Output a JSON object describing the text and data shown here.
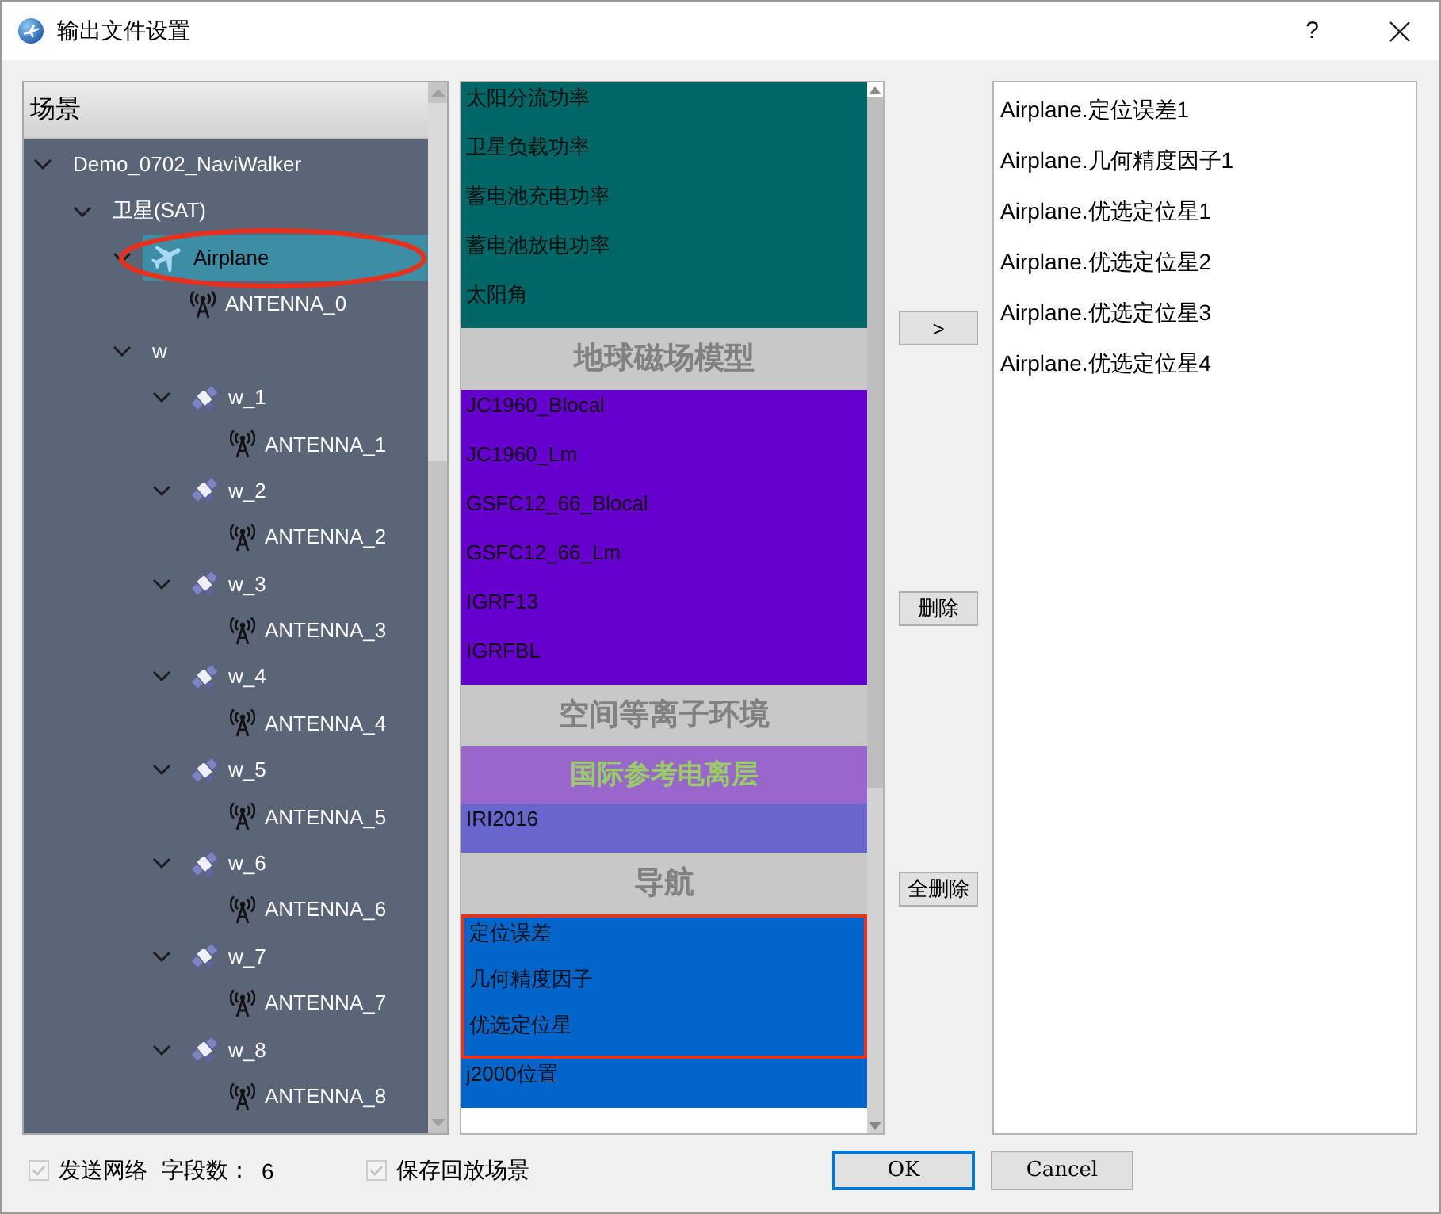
{
  "window": {
    "title": "输出文件设置",
    "help_label": "?"
  },
  "scene_tree": {
    "header": "场景",
    "nodes": [
      {
        "label": "Demo_0702_NaviWalker",
        "expanded": true,
        "selected": false,
        "circled": false,
        "children": [
          {
            "label": "卫星(SAT)",
            "expanded": true,
            "selected": false,
            "circled": false,
            "children": [
              {
                "label": "Airplane",
                "kind": "airplane",
                "expanded": true,
                "selected": true,
                "circled": true,
                "children": [
                  {
                    "label": "ANTENNA_0",
                    "kind": "antenna",
                    "selected": false,
                    "circled": false
                  }
                ]
              },
              {
                "label": "w",
                "expanded": true,
                "selected": false,
                "circled": false,
                "children": [
                  {
                    "label": "w_1",
                    "kind": "satellite",
                    "expanded": true,
                    "selected": false,
                    "circled": false,
                    "children": [
                      {
                        "label": "ANTENNA_1",
                        "kind": "antenna",
                        "selected": false,
                        "circled": false
                      }
                    ]
                  },
                  {
                    "label": "w_2",
                    "kind": "satellite",
                    "expanded": true,
                    "selected": false,
                    "circled": false,
                    "children": [
                      {
                        "label": "ANTENNA_2",
                        "kind": "antenna",
                        "selected": false,
                        "circled": false
                      }
                    ]
                  },
                  {
                    "label": "w_3",
                    "kind": "satellite",
                    "expanded": true,
                    "selected": false,
                    "circled": false,
                    "children": [
                      {
                        "label": "ANTENNA_3",
                        "kind": "antenna",
                        "selected": false,
                        "circled": false
                      }
                    ]
                  },
                  {
                    "label": "w_4",
                    "kind": "satellite",
                    "expanded": true,
                    "selected": false,
                    "circled": false,
                    "children": [
                      {
                        "label": "ANTENNA_4",
                        "kind": "antenna",
                        "selected": false,
                        "circled": false
                      }
                    ]
                  },
                  {
                    "label": "w_5",
                    "kind": "satellite",
                    "expanded": true,
                    "selected": false,
                    "circled": false,
                    "children": [
                      {
                        "label": "ANTENNA_5",
                        "kind": "antenna",
                        "selected": false,
                        "circled": false
                      }
                    ]
                  },
                  {
                    "label": "w_6",
                    "kind": "satellite",
                    "expanded": true,
                    "selected": false,
                    "circled": false,
                    "children": [
                      {
                        "label": "ANTENNA_6",
                        "kind": "antenna",
                        "selected": false,
                        "circled": false
                      }
                    ]
                  },
                  {
                    "label": "w_7",
                    "kind": "satellite",
                    "expanded": true,
                    "selected": false,
                    "circled": false,
                    "children": [
                      {
                        "label": "ANTENNA_7",
                        "kind": "antenna",
                        "selected": false,
                        "circled": false
                      }
                    ]
                  },
                  {
                    "label": "w_8",
                    "kind": "satellite",
                    "expanded": true,
                    "selected": false,
                    "circled": false,
                    "children": [
                      {
                        "label": "ANTENNA_8",
                        "kind": "antenna",
                        "selected": false,
                        "circled": false
                      }
                    ]
                  }
                ]
              }
            ]
          }
        ]
      }
    ]
  },
  "parameter_list": {
    "entries": [
      {
        "kind": "item",
        "label": "太阳分流功率",
        "color": "#006666",
        "boxed": false
      },
      {
        "kind": "item",
        "label": "卫星负载功率",
        "color": "#006666",
        "boxed": false
      },
      {
        "kind": "item",
        "label": "蓄电池充电功率",
        "color": "#006666",
        "boxed": false
      },
      {
        "kind": "item",
        "label": "蓄电池放电功率",
        "color": "#006666",
        "boxed": false
      },
      {
        "kind": "item",
        "label": "太阳角",
        "color": "#006666",
        "boxed": false
      },
      {
        "kind": "header",
        "label": "地球磁场模型"
      },
      {
        "kind": "item",
        "label": "JC1960_Blocal",
        "color": "#6600cc",
        "boxed": false
      },
      {
        "kind": "item",
        "label": "JC1960_Lm",
        "color": "#6600cc",
        "boxed": false
      },
      {
        "kind": "item",
        "label": "GSFC12_66_Blocal",
        "color": "#6600cc",
        "boxed": false
      },
      {
        "kind": "item",
        "label": "GSFC12_66_Lm",
        "color": "#6600cc",
        "boxed": false
      },
      {
        "kind": "item",
        "label": "IGRF13",
        "color": "#6600cc",
        "boxed": false
      },
      {
        "kind": "item",
        "label": "IGRFBL",
        "color": "#6600cc",
        "boxed": false
      },
      {
        "kind": "header",
        "label": "空间等离子环境"
      },
      {
        "kind": "subheader",
        "label": "国际参考电离层"
      },
      {
        "kind": "item",
        "label": "IRI2016",
        "color": "#6666cc",
        "boxed": false
      },
      {
        "kind": "header",
        "label": "导航"
      },
      {
        "kind": "item",
        "label": "定位误差",
        "color": "#0066cc",
        "boxed": true
      },
      {
        "kind": "item",
        "label": "几何精度因子",
        "color": "#0066cc",
        "boxed": true
      },
      {
        "kind": "item",
        "label": "优选定位星",
        "color": "#0066cc",
        "boxed": true
      },
      {
        "kind": "item",
        "label": "j2000位置",
        "color": "#0066cc",
        "boxed": false
      }
    ]
  },
  "transfer_buttons": [
    ">",
    "删除",
    "全删除"
  ],
  "output_fields": [
    "Airplane.定位误差1",
    "Airplane.几何精度因子1",
    "Airplane.优选定位星1",
    "Airplane.优选定位星2",
    "Airplane.优选定位星3",
    "Airplane.优选定位星4"
  ],
  "footer": {
    "send_network": {
      "label": "发送网络",
      "checked": true,
      "disabled": true
    },
    "field_count_label": "字段数：",
    "field_count": "6",
    "save_playback": {
      "label": "保存回放场景",
      "checked": true,
      "disabled": true
    },
    "buttons": [
      {
        "label": "OK",
        "default": true
      },
      {
        "label": "Cancel",
        "default": false
      }
    ]
  }
}
